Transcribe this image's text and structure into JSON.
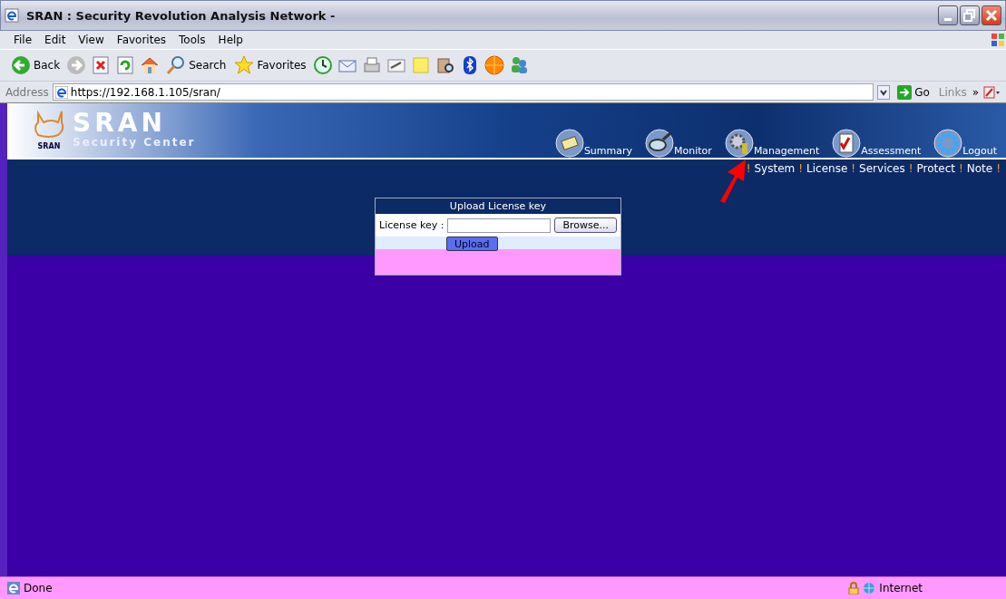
{
  "window": {
    "title": "SRAN : Security Revolution Analysis Network -"
  },
  "menu": [
    "File",
    "Edit",
    "View",
    "Favorites",
    "Tools",
    "Help"
  ],
  "toolbar": [
    {
      "kind": "back",
      "label": "Back"
    },
    {
      "kind": "forward"
    },
    {
      "kind": "stop"
    },
    {
      "kind": "refresh"
    },
    {
      "kind": "home"
    },
    {
      "kind": "search",
      "label": "Search"
    },
    {
      "kind": "favorites",
      "label": "Favorites"
    },
    {
      "kind": "history"
    },
    {
      "kind": "mail"
    },
    {
      "kind": "print"
    },
    {
      "kind": "edit"
    },
    {
      "kind": "note"
    },
    {
      "kind": "research"
    },
    {
      "kind": "bluetooth"
    },
    {
      "kind": "globe"
    },
    {
      "kind": "messenger"
    }
  ],
  "address": {
    "label": "Address",
    "value": "https://192.168.1.105/sran/",
    "go": "Go",
    "links": "Links",
    "more": "»"
  },
  "site": {
    "logo_small": "SRAN",
    "logo": "SRAN",
    "tagline": "Security Center",
    "nav": [
      "Summary",
      "Monitor",
      "Management",
      "Assessment",
      "Logout"
    ],
    "subnav_separator": "!",
    "subnav": [
      "System",
      "License",
      "Services",
      "Protect",
      "Note"
    ]
  },
  "form": {
    "title": "Upload License key",
    "label": "License key :",
    "browse": "Browse...",
    "upload": "Upload"
  },
  "status_bar": {
    "text": "Done",
    "zone": "Internet"
  }
}
